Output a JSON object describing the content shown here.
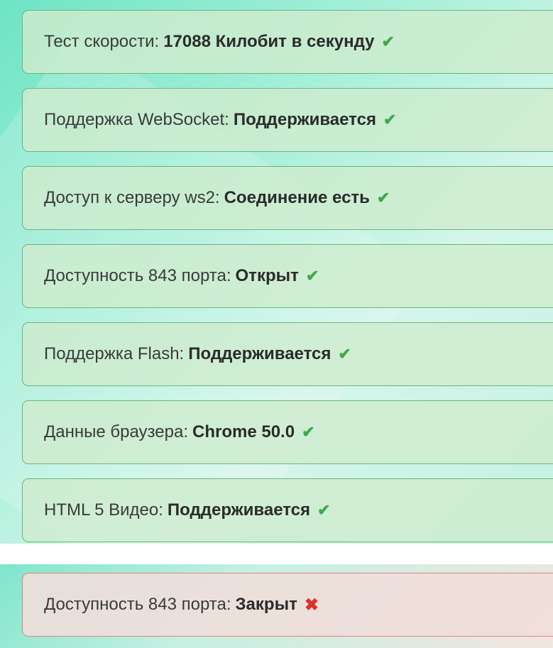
{
  "checks": [
    {
      "label": "Тест скорости:",
      "value": "17088 Килобит в секунду",
      "status": "ok",
      "icon": "✔"
    },
    {
      "label": "Поддержка WebSocket:",
      "value": "Поддерживается",
      "status": "ok",
      "icon": "✔"
    },
    {
      "label": "Доступ к серверу ws2:",
      "value": "Соединение есть",
      "status": "ok",
      "icon": "✔"
    },
    {
      "label": "Доступность 843 порта:",
      "value": "Открыт",
      "status": "ok",
      "icon": "✔"
    },
    {
      "label": "Поддержка Flash:",
      "value": "Поддерживается",
      "status": "ok",
      "icon": "✔"
    },
    {
      "label": "Данные браузера:",
      "value": "Chrome 50.0",
      "status": "ok",
      "icon": "✔"
    },
    {
      "label": "HTML 5 Видео:",
      "value": "Поддерживается",
      "status": "ok",
      "icon": "✔"
    }
  ],
  "error_check": {
    "label": "Доступность 843 порта:",
    "value": "Закрыт",
    "status": "error",
    "icon": "✖"
  },
  "colors": {
    "ok_border": "#6cb57d",
    "ok_icon": "#3fa84a",
    "error_border": "#e2827e",
    "error_icon": "#d9342b"
  }
}
